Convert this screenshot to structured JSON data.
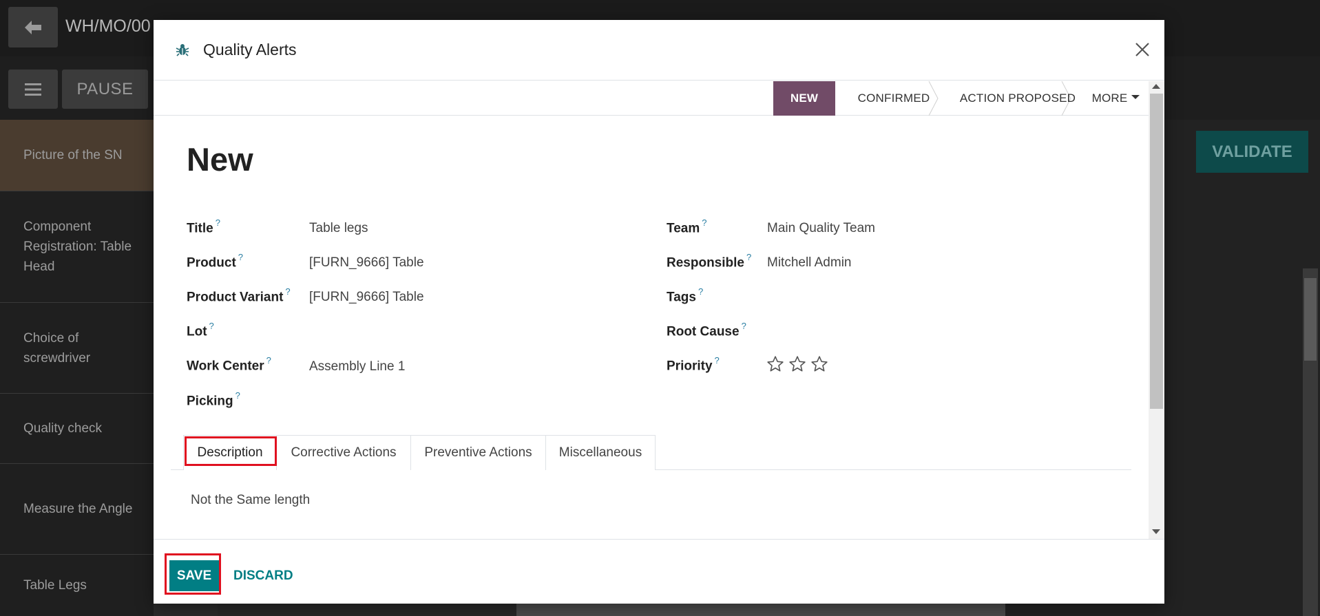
{
  "background": {
    "reference": "WH/MO/00",
    "pause_label": "PAUSE",
    "validate_label": "VALIDATE",
    "sidebar_items": [
      {
        "label": "Picture of the SN"
      },
      {
        "label": "Component Registration: Table Head"
      },
      {
        "label": "Choice of screwdriver"
      },
      {
        "label": "Quality check"
      },
      {
        "label": "Measure the Angle"
      },
      {
        "label": "Table Legs"
      }
    ]
  },
  "modal": {
    "title": "Quality Alerts",
    "icon": "bug-icon",
    "stages": {
      "new": "NEW",
      "confirmed": "CONFIRMED",
      "action_proposed": "ACTION PROPOSED",
      "more": "MORE"
    },
    "record_title": "New",
    "help_mark": "?",
    "fields": {
      "title": {
        "label": "Title",
        "value": "Table legs"
      },
      "product": {
        "label": "Product",
        "value": "[FURN_9666] Table"
      },
      "product_variant": {
        "label": "Product Variant",
        "value": "[FURN_9666] Table"
      },
      "lot": {
        "label": "Lot",
        "value": ""
      },
      "work_center": {
        "label": "Work Center",
        "value": "Assembly Line 1"
      },
      "picking": {
        "label": "Picking",
        "value": ""
      },
      "team": {
        "label": "Team",
        "value": "Main Quality Team"
      },
      "responsible": {
        "label": "Responsible",
        "value": "Mitchell Admin"
      },
      "tags": {
        "label": "Tags",
        "value": ""
      },
      "root_cause": {
        "label": "Root Cause",
        "value": ""
      },
      "priority": {
        "label": "Priority",
        "stars_filled": 0,
        "stars_total": 3
      }
    },
    "tabs": [
      {
        "label": "Description"
      },
      {
        "label": "Corrective Actions"
      },
      {
        "label": "Preventive Actions"
      },
      {
        "label": "Miscellaneous"
      }
    ],
    "active_tab": "Description",
    "description": "Not the Same length",
    "footer": {
      "save_label": "SAVE",
      "discard_label": "DISCARD"
    }
  },
  "colors": {
    "brand_primary": "#017e84",
    "stage_active": "#714b67",
    "highlight": "#e0101f"
  }
}
